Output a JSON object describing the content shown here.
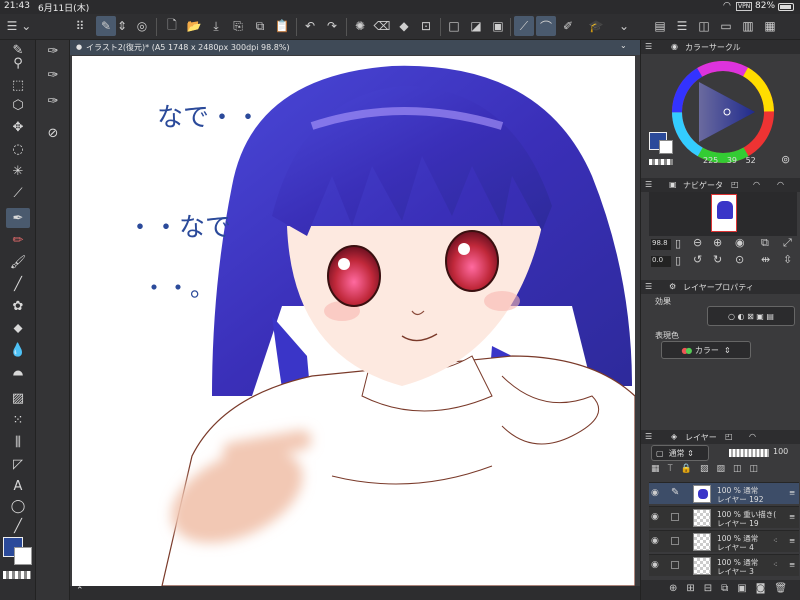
{
  "status_bar": {
    "time": "21:43",
    "date": "6月11日(木)",
    "vpn": "VPN",
    "battery": "82%"
  },
  "document_tab": {
    "title": "イラスト2(復元)* (A5 1748 x 2480px 300dpi 98.8%)"
  },
  "canvas": {
    "handwritten_text_1": "なで・・",
    "handwritten_text_2": "・・なで",
    "handwritten_text_3": "・・。"
  },
  "color_circle": {
    "title": "カラーサークル",
    "h": "225",
    "s": "39",
    "v": "52",
    "accent": "#2b4a9a"
  },
  "navigator": {
    "title": "ナビゲータ",
    "zoom": "98.8",
    "rotation": "0.0"
  },
  "layer_property": {
    "title": "レイヤープロパティ",
    "effect_label": "効果",
    "expression_label": "表現色",
    "expression_value": "カラー"
  },
  "layer_panel": {
    "title": "レイヤー",
    "blend_mode": "通常",
    "opacity": "100",
    "layers": [
      {
        "line1": "100 % 通常",
        "line2": "レイヤー 192"
      },
      {
        "line1": "100 % 重い描き(",
        "line2": "レイヤー 19"
      },
      {
        "line1": "100 % 通常",
        "line2": "レイヤー 4"
      },
      {
        "line1": "100 % 通常",
        "line2": "レイヤー 3"
      }
    ]
  }
}
